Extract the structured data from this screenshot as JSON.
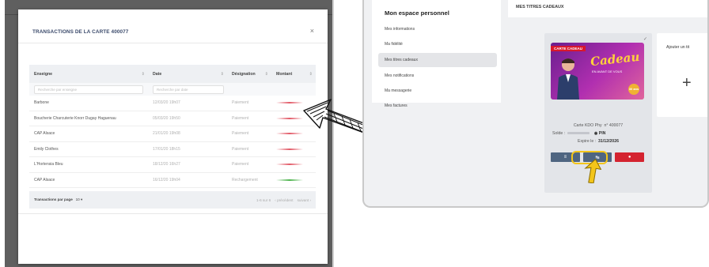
{
  "modal": {
    "title": "TRANSACTIONS DE LA CARTE 400077",
    "close": "×",
    "columns": [
      {
        "label": "Enseigne",
        "sort": "⇕"
      },
      {
        "label": "Date",
        "sort": "⇕"
      },
      {
        "label": "Désignation",
        "sort": "⇕"
      },
      {
        "label": "Montant",
        "sort": "⇕"
      }
    ],
    "filters": {
      "enseigne": "Recherche par enseigne",
      "date": "Recherche par date"
    },
    "rows": [
      {
        "enseigne": "Barbone",
        "date": "12/03/20 19h07",
        "designation": "Paiement",
        "amount_color": "#e25b68"
      },
      {
        "enseigne": "Boucherie Charcuterie Knorr Dugay Haguenau",
        "date": "05/03/20 19h50",
        "designation": "Paiement",
        "amount_color": "#e25b68"
      },
      {
        "enseigne": "CAP Alsace",
        "date": "21/01/20 19h08",
        "designation": "Paiement",
        "amount_color": "#e25b68"
      },
      {
        "enseigne": "Emily Clothes",
        "date": "17/01/20 18h15",
        "designation": "Paiement",
        "amount_color": "#e25b68"
      },
      {
        "enseigne": "L'Hortensia Bleu",
        "date": "18/12/20 16h27",
        "designation": "Paiement",
        "amount_color": "#e25b68"
      },
      {
        "enseigne": "CAP Alsace",
        "date": "16/12/20 19h04",
        "designation": "Rechargement",
        "amount_color": "#4fb44f"
      }
    ],
    "footer": {
      "per_page": "Transactions par page",
      "per_page_value": "10",
      "range": "1-6 sur 6",
      "prev": "‹ précédent",
      "next": "suivant ›"
    }
  },
  "sidebar": {
    "title": "Mon espace personnel",
    "items": [
      "Mes informations",
      "Ma fidélité",
      "Mes titres cadeaux",
      "Mes notifications",
      "Ma messagerie",
      "Mes factures"
    ],
    "active_index": 2
  },
  "main": {
    "title": "MES TITRES CADEAUX",
    "card": {
      "check": "✓",
      "ribbon": "CARTE CADEAU",
      "image_title": "Cadeau",
      "image_sub": "EN AVANT DE VOUS",
      "badge": "30 ans",
      "line1_label": "Carte KDO Phy",
      "line1_value": "n° 400077",
      "line2_label": "Solde :",
      "line2_pin": "◉ PIN",
      "line3_label": "Expire le :",
      "line3_value": "31/12/2026",
      "buttons": [
        "≡",
        "↹",
        "●"
      ]
    },
    "add_card": {
      "label": "Ajouter un tit",
      "plus": "+"
    }
  }
}
